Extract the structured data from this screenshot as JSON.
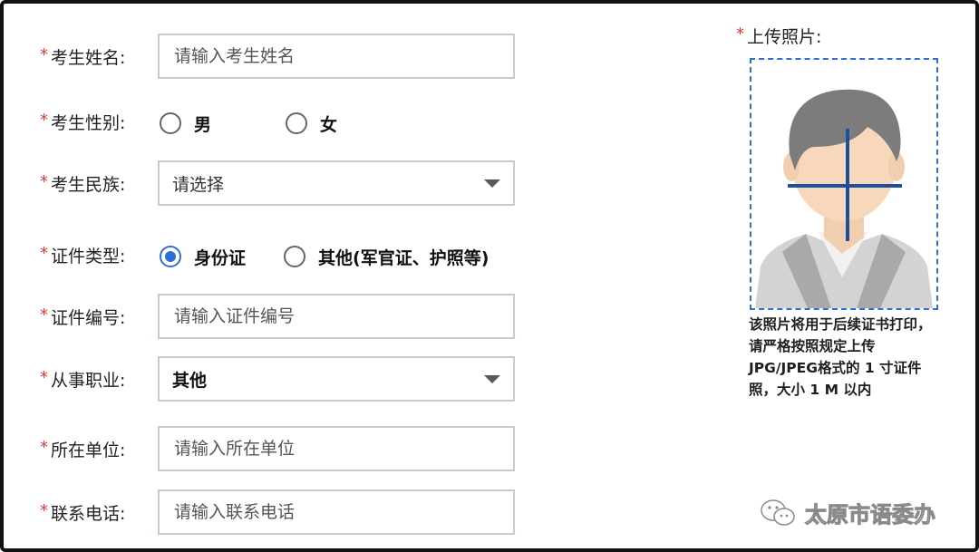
{
  "form": {
    "required_mark": "*",
    "name": {
      "label": "考生姓名:",
      "placeholder": "请输入考生姓名"
    },
    "gender": {
      "label": "考生性别:",
      "options": [
        "男",
        "女"
      ],
      "selected": null
    },
    "ethnicity": {
      "label": "考生民族:",
      "value": "请选择"
    },
    "id_type": {
      "label": "证件类型:",
      "options": [
        "身份证",
        "其他(军官证、护照等)"
      ],
      "selected": 0
    },
    "id_number": {
      "label": "证件编号:",
      "placeholder": "请输入证件编号"
    },
    "occupation": {
      "label": "从事职业:",
      "value": "其他"
    },
    "employer": {
      "label": "所在单位:",
      "placeholder": "请输入所在单位"
    },
    "phone": {
      "label": "联系电话:",
      "placeholder": "请输入联系电话"
    }
  },
  "upload": {
    "title": "上传照片:",
    "note": "该照片将用于后续证书打印，请严格按照规定上传JPG/JPEG格式的 1 寸证件照，大小 1 M 以内"
  },
  "watermark": {
    "text": "太原市语委办",
    "icon": "wechat-icon"
  },
  "colors": {
    "required": "#e23b2e",
    "accent": "#2d6fd8",
    "border": "#c5cbd6"
  }
}
